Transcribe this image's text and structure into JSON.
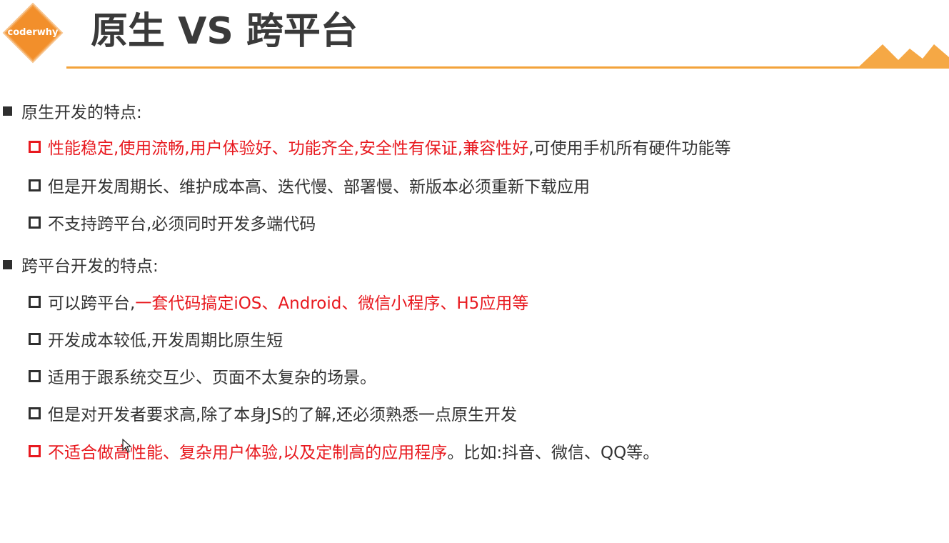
{
  "header": {
    "logo_text": "coderwhy",
    "title": "原生 VS 跨平台"
  },
  "colors": {
    "accent": "#f3a33a",
    "highlight_red": "#e8191f",
    "text": "#333333"
  },
  "sections": [
    {
      "label": "原生开发的特点:",
      "items": [
        {
          "red": "性能稳定,使用流畅,用户体验好、功能齐全,安全性有保证,兼容性好",
          "normal": ",可使用手机所有硬件功能等"
        },
        {
          "normal": "但是开发周期长、维护成本高、迭代慢、部署慢、新版本必须重新下载应用"
        },
        {
          "normal": "不支持跨平台,必须同时开发多端代码"
        }
      ]
    },
    {
      "label": "跨平台开发的特点:",
      "items": [
        {
          "normal": "可以跨平台,",
          "red": "一套代码搞定iOS、Android、微信小程序、H5应用等"
        },
        {
          "normal": "开发成本较低,开发周期比原生短"
        },
        {
          "normal": "适用于跟系统交互少、页面不太复杂的场景。"
        },
        {
          "normal": "但是对开发者要求高,除了本身JS的了解,还必须熟悉一点原生开发"
        },
        {
          "red": "不适合做高性能、复杂用户体验,以及定制高的应用程序",
          "normal": "。比如:抖音、微信、QQ等。"
        }
      ]
    }
  ]
}
